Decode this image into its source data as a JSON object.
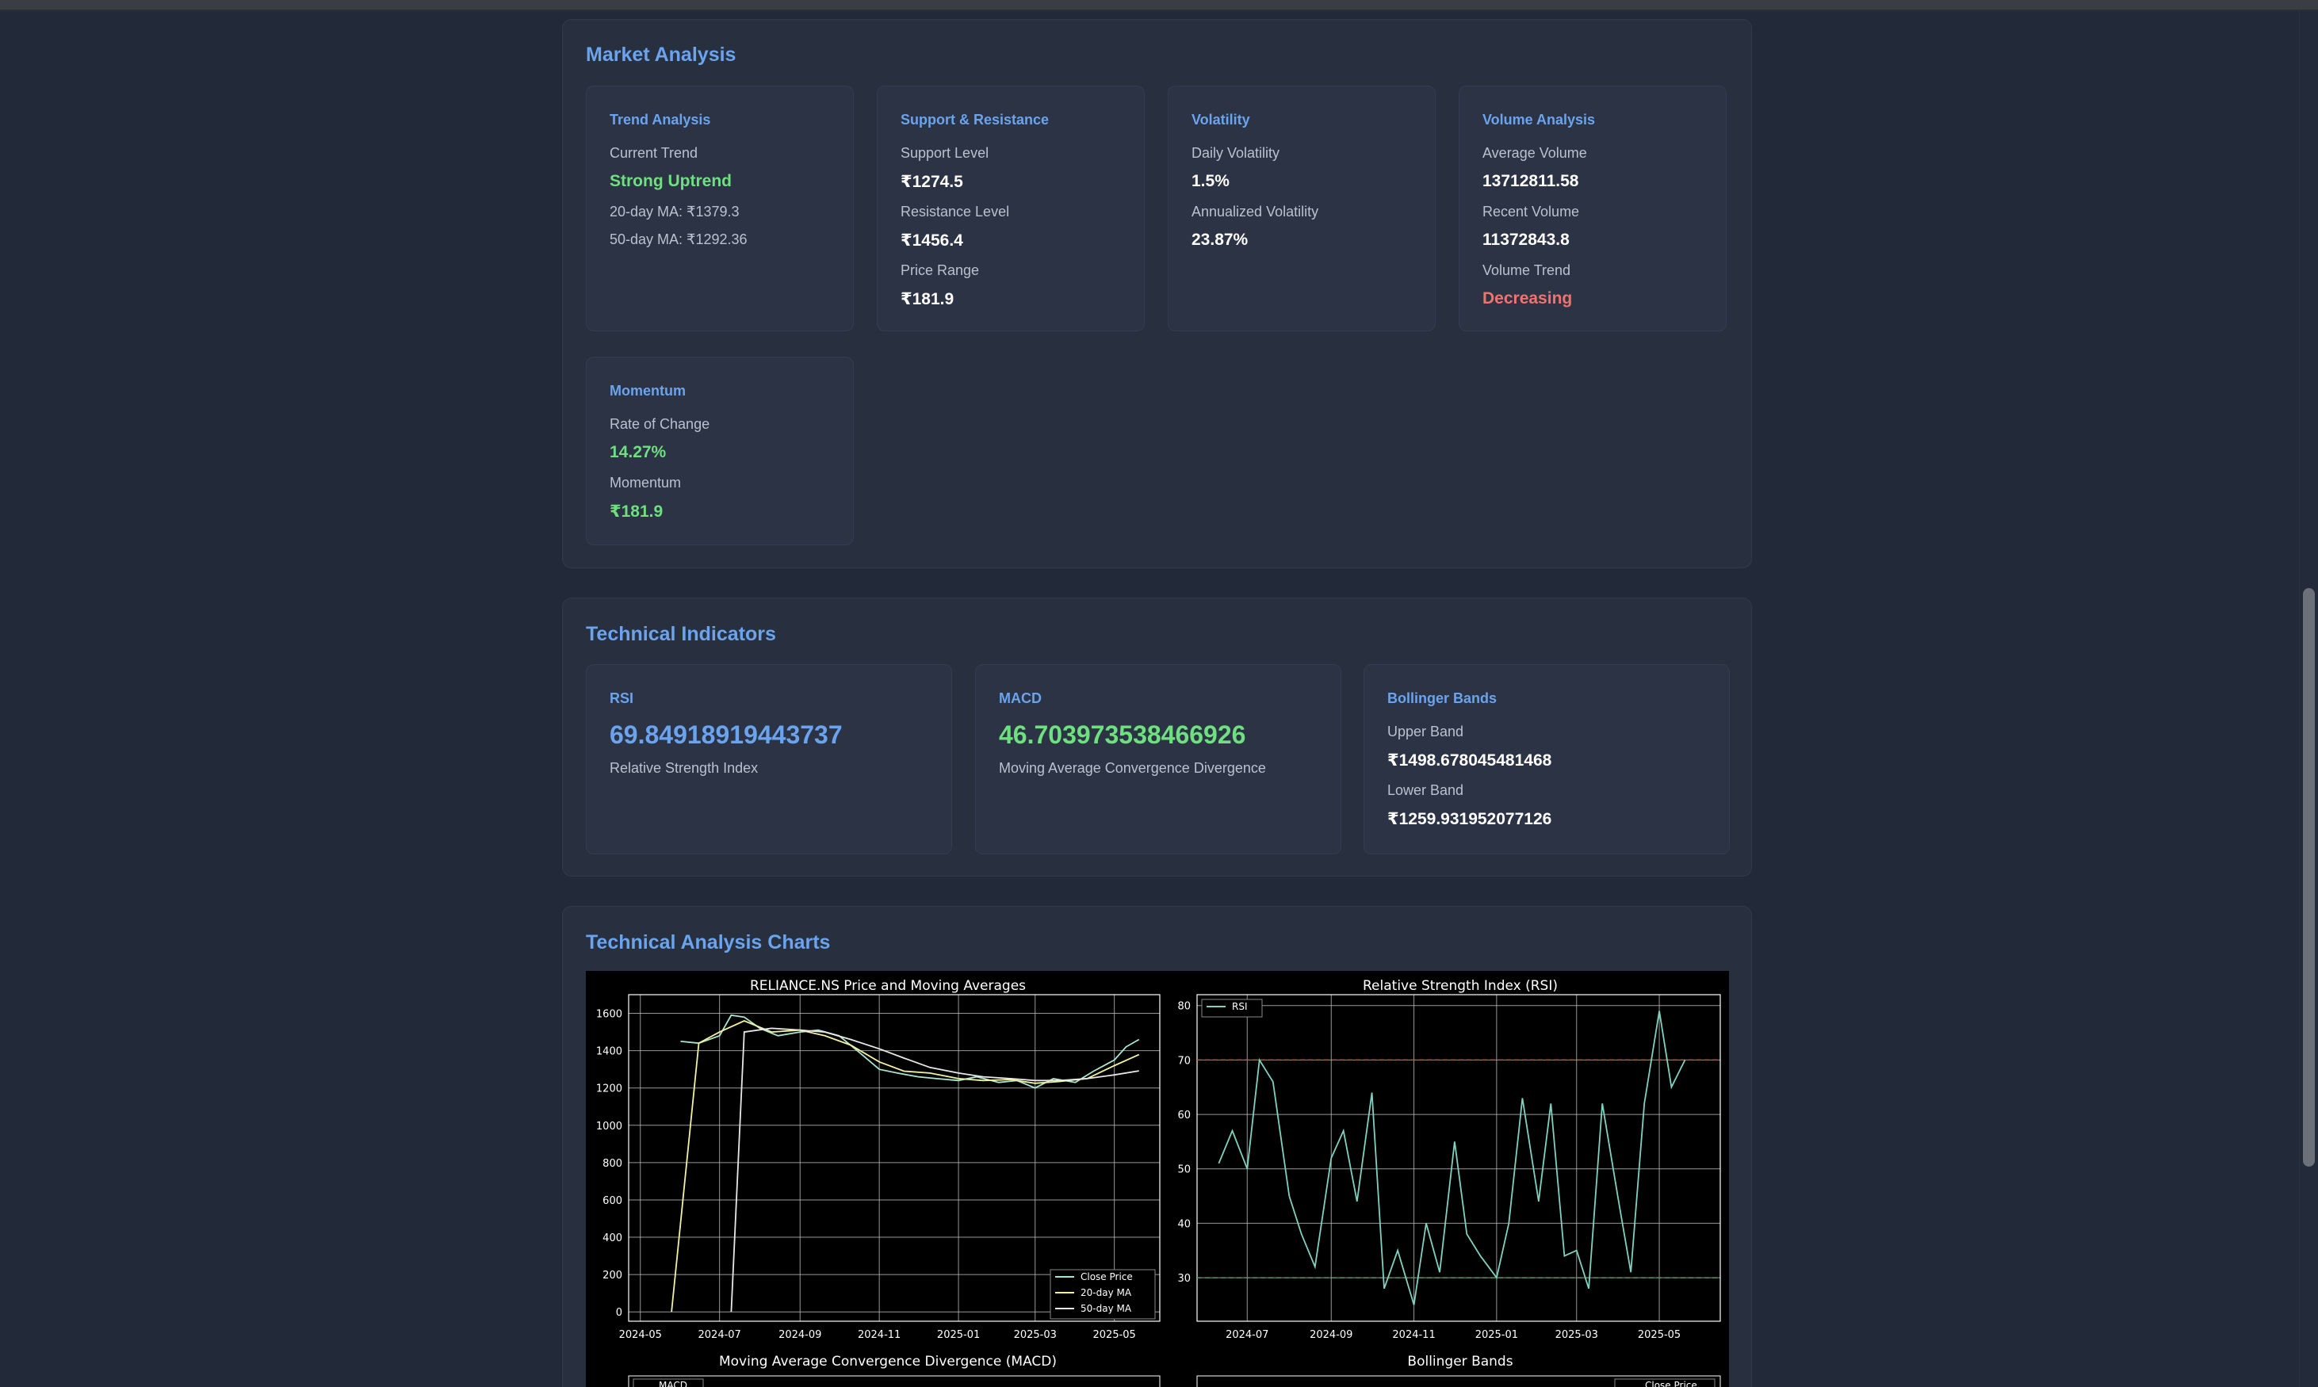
{
  "market": {
    "title": "Market Analysis",
    "trend": {
      "title": "Trend Analysis",
      "current_label": "Current Trend",
      "current_value": "Strong Uptrend",
      "ma20": "20-day MA: ₹1379.3",
      "ma50": "50-day MA: ₹1292.36"
    },
    "support": {
      "title": "Support & Resistance",
      "support_label": "Support Level",
      "support_value": "₹1274.5",
      "resistance_label": "Resistance Level",
      "resistance_value": "₹1456.4",
      "range_label": "Price Range",
      "range_value": "₹181.9"
    },
    "volatility": {
      "title": "Volatility",
      "daily_label": "Daily Volatility",
      "daily_value": "1.5%",
      "annual_label": "Annualized Volatility",
      "annual_value": "23.87%"
    },
    "volume": {
      "title": "Volume Analysis",
      "avg_label": "Average Volume",
      "avg_value": "13712811.58",
      "recent_label": "Recent Volume",
      "recent_value": "11372843.8",
      "trend_label": "Volume Trend",
      "trend_value": "Decreasing"
    },
    "momentum": {
      "title": "Momentum",
      "roc_label": "Rate of Change",
      "roc_value": "14.27%",
      "mom_label": "Momentum",
      "mom_value": "₹181.9"
    }
  },
  "indicators": {
    "title": "Technical Indicators",
    "rsi": {
      "title": "RSI",
      "value": "69.84918919443737",
      "desc": "Relative Strength Index"
    },
    "macd": {
      "title": "MACD",
      "value": "46.703973538466926",
      "desc": "Moving Average Convergence Divergence"
    },
    "bollinger": {
      "title": "Bollinger Bands",
      "upper_label": "Upper Band",
      "upper_value": "₹1498.678045481468",
      "lower_label": "Lower Band",
      "lower_value": "₹1259.931952077126"
    }
  },
  "charts": {
    "title": "Technical Analysis Charts",
    "price_title": "RELIANCE.NS Price and Moving Averages",
    "rsi_title": "Relative Strength Index (RSI)",
    "macd_title": "Moving Average Convergence Divergence (MACD)",
    "bb_title": "Bollinger Bands",
    "legend_macd_partial": "MACD",
    "legend_bb_partial": "Close Price"
  },
  "colors": {
    "accent": "#6aa3ee",
    "positive": "#6ee07f",
    "negative": "#f0736f",
    "background": "#222a3a",
    "panel": "#28303f"
  },
  "chart_data": [
    {
      "type": "line",
      "title": "RELIANCE.NS Price and Moving Averages",
      "x_ticks": [
        "2024-05",
        "2024-07",
        "2024-09",
        "2024-11",
        "2025-01",
        "2025-03",
        "2025-05"
      ],
      "y_ticks": [
        0,
        200,
        400,
        600,
        800,
        1000,
        1200,
        1400,
        1600
      ],
      "ylim": [
        -50,
        1700
      ],
      "grid": true,
      "legend": "bottom-right",
      "series": [
        {
          "name": "Close Price",
          "x": [
            "2024-06-01",
            "2024-06-15",
            "2024-07-01",
            "2024-07-10",
            "2024-07-20",
            "2024-08-01",
            "2024-08-15",
            "2024-09-01",
            "2024-09-15",
            "2024-10-01",
            "2024-10-15",
            "2024-11-01",
            "2024-11-15",
            "2024-12-01",
            "2024-12-15",
            "2025-01-01",
            "2025-01-15",
            "2025-02-01",
            "2025-02-15",
            "2025-03-01",
            "2025-03-15",
            "2025-04-01",
            "2025-04-15",
            "2025-05-01",
            "2025-05-10",
            "2025-05-20"
          ],
          "y": [
            1450,
            1440,
            1480,
            1590,
            1580,
            1520,
            1480,
            1500,
            1510,
            1480,
            1400,
            1300,
            1280,
            1260,
            1250,
            1240,
            1260,
            1230,
            1240,
            1200,
            1250,
            1230,
            1290,
            1350,
            1420,
            1460
          ]
        },
        {
          "name": "20-day MA",
          "x": [
            "2024-05-25",
            "2024-06-15",
            "2024-07-01",
            "2024-07-20",
            "2024-08-10",
            "2024-09-01",
            "2024-09-20",
            "2024-10-10",
            "2024-11-01",
            "2024-11-20",
            "2024-12-10",
            "2025-01-01",
            "2025-01-20",
            "2025-02-10",
            "2025-03-01",
            "2025-03-20",
            "2025-04-10",
            "2025-05-01",
            "2025-05-20"
          ],
          "y": [
            0,
            1440,
            1500,
            1560,
            1500,
            1510,
            1480,
            1430,
            1340,
            1290,
            1280,
            1250,
            1240,
            1245,
            1225,
            1235,
            1250,
            1320,
            1379
          ]
        },
        {
          "name": "50-day MA",
          "x": [
            "2024-07-10",
            "2024-07-20",
            "2024-08-10",
            "2024-09-01",
            "2024-09-20",
            "2024-10-10",
            "2024-11-01",
            "2024-11-20",
            "2024-12-10",
            "2025-01-01",
            "2025-01-20",
            "2025-02-10",
            "2025-03-01",
            "2025-03-20",
            "2025-04-10",
            "2025-05-01",
            "2025-05-20"
          ],
          "y": [
            0,
            1500,
            1520,
            1510,
            1500,
            1460,
            1410,
            1360,
            1310,
            1280,
            1260,
            1250,
            1240,
            1240,
            1250,
            1270,
            1292
          ]
        }
      ]
    },
    {
      "type": "line",
      "title": "Relative Strength Index (RSI)",
      "x_ticks": [
        "2024-07",
        "2024-09",
        "2024-11",
        "2025-01",
        "2025-03",
        "2025-05"
      ],
      "y_ticks": [
        30,
        40,
        50,
        60,
        70,
        80
      ],
      "ylim": [
        22,
        82
      ],
      "grid": true,
      "legend": "top-left",
      "reference_lines": [
        70,
        30
      ],
      "series": [
        {
          "name": "RSI",
          "x": [
            "2024-06-10",
            "2024-06-20",
            "2024-07-01",
            "2024-07-10",
            "2024-07-20",
            "2024-08-01",
            "2024-08-10",
            "2024-08-20",
            "2024-09-01",
            "2024-09-10",
            "2024-09-20",
            "2024-10-01",
            "2024-10-10",
            "2024-10-20",
            "2024-11-01",
            "2024-11-10",
            "2024-11-20",
            "2024-12-01",
            "2024-12-10",
            "2024-12-20",
            "2025-01-01",
            "2025-01-10",
            "2025-01-20",
            "2025-02-01",
            "2025-02-10",
            "2025-02-20",
            "2025-03-01",
            "2025-03-10",
            "2025-03-20",
            "2025-04-01",
            "2025-04-10",
            "2025-04-20",
            "2025-05-01",
            "2025-05-10",
            "2025-05-20"
          ],
          "y": [
            51,
            57,
            50,
            70,
            66,
            45,
            38,
            32,
            52,
            57,
            44,
            64,
            28,
            35,
            25,
            40,
            31,
            55,
            38,
            34,
            30,
            40,
            63,
            44,
            62,
            34,
            35,
            28,
            62,
            44,
            31,
            62,
            79,
            65,
            70
          ]
        }
      ]
    },
    {
      "type": "line",
      "title": "Moving Average Convergence Divergence (MACD)",
      "series": [
        {
          "name": "MACD",
          "values": []
        }
      ]
    },
    {
      "type": "line",
      "title": "Bollinger Bands",
      "series": [
        {
          "name": "Close Price",
          "values": []
        }
      ]
    }
  ]
}
